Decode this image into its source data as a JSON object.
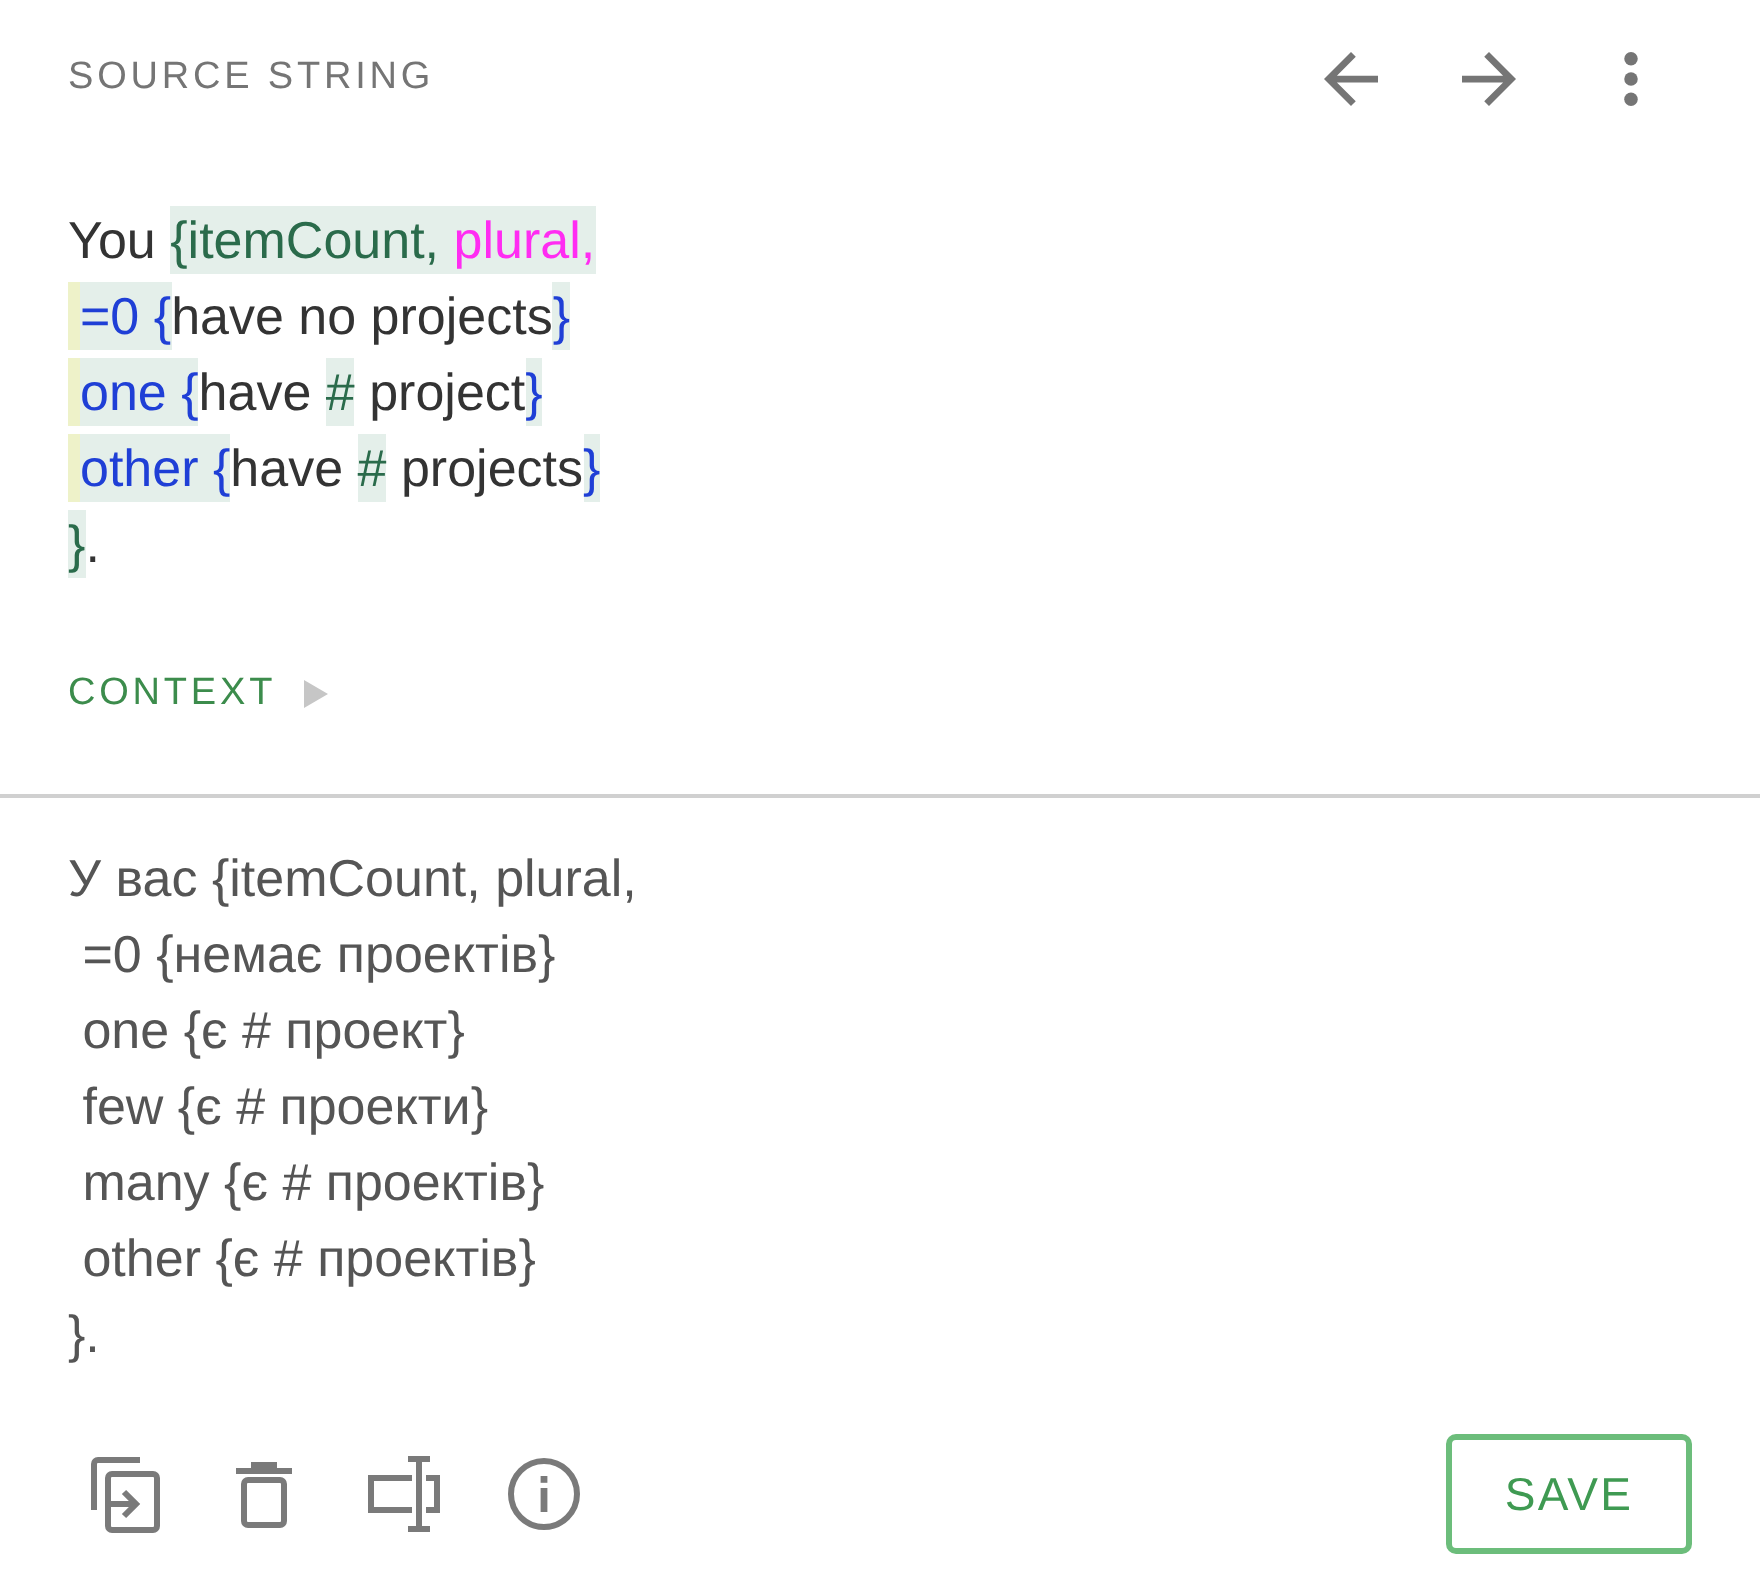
{
  "header": {
    "title": "SOURCE STRING"
  },
  "source": {
    "lines": [
      {
        "indented": false,
        "segments": [
          {
            "kind": "text",
            "text": "You "
          },
          {
            "kind": "argument",
            "text": "{itemCount, "
          },
          {
            "kind": "format",
            "text": "plural,"
          }
        ]
      },
      {
        "indented": true,
        "segments": [
          {
            "kind": "selector",
            "text": "=0 {"
          },
          {
            "kind": "text",
            "text": "have no projects"
          },
          {
            "kind": "selector",
            "text": "}"
          }
        ]
      },
      {
        "indented": true,
        "segments": [
          {
            "kind": "selector",
            "text": "one {"
          },
          {
            "kind": "text",
            "text": "have "
          },
          {
            "kind": "hash",
            "text": "#"
          },
          {
            "kind": "text",
            "text": " project"
          },
          {
            "kind": "selector",
            "text": "}"
          }
        ]
      },
      {
        "indented": true,
        "segments": [
          {
            "kind": "selector",
            "text": "other {"
          },
          {
            "kind": "text",
            "text": "have "
          },
          {
            "kind": "hash",
            "text": "#"
          },
          {
            "kind": "text",
            "text": " projects"
          },
          {
            "kind": "selector",
            "text": "}"
          }
        ]
      },
      {
        "indented": false,
        "segments": [
          {
            "kind": "argument",
            "text": "}"
          },
          {
            "kind": "text",
            "text": "."
          }
        ]
      }
    ]
  },
  "context": {
    "label": "CONTEXT",
    "expanded": false
  },
  "translation": {
    "value": "У вас {itemCount, plural,\n =0 {немає проектів}\n one {є # проект}\n few {є # проекти}\n many {є # проектів}\n other {є # проектів}\n}."
  },
  "save_button": {
    "label": "SAVE"
  }
}
